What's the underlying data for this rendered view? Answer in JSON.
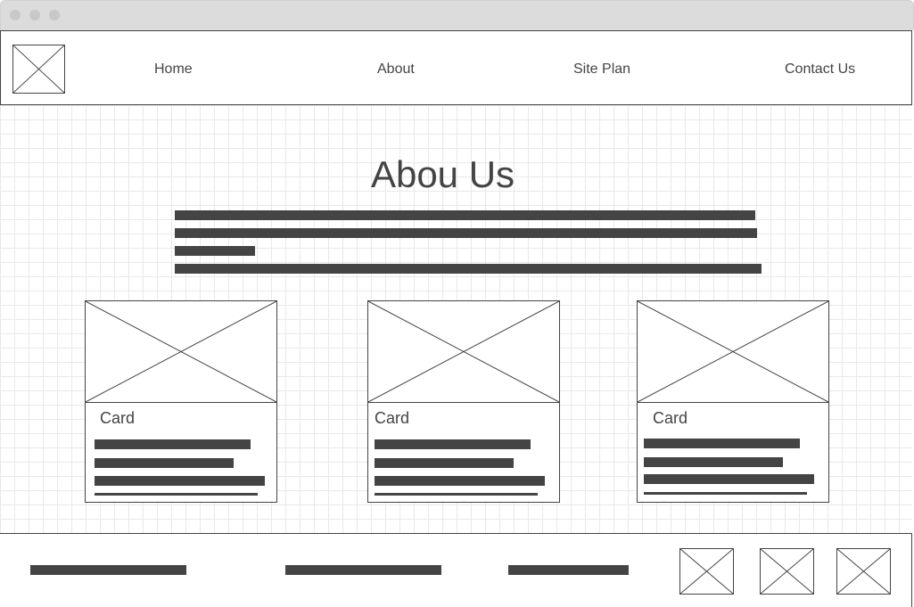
{
  "nav": {
    "items": [
      {
        "label": "Home"
      },
      {
        "label": "About"
      },
      {
        "label": "Site Plan"
      },
      {
        "label": "Contact Us"
      }
    ]
  },
  "main": {
    "title": "Abou Us",
    "cards": [
      {
        "title": "Card"
      },
      {
        "title": "Card"
      },
      {
        "title": "Card"
      }
    ]
  },
  "icons": {
    "logo": "image-placeholder-icon",
    "card_image": "image-placeholder-icon",
    "footer_images": "image-placeholder-icon"
  },
  "colors": {
    "ink": "#444444",
    "grid": "#e9e9e9",
    "titlebar": "#dcdcdc"
  }
}
